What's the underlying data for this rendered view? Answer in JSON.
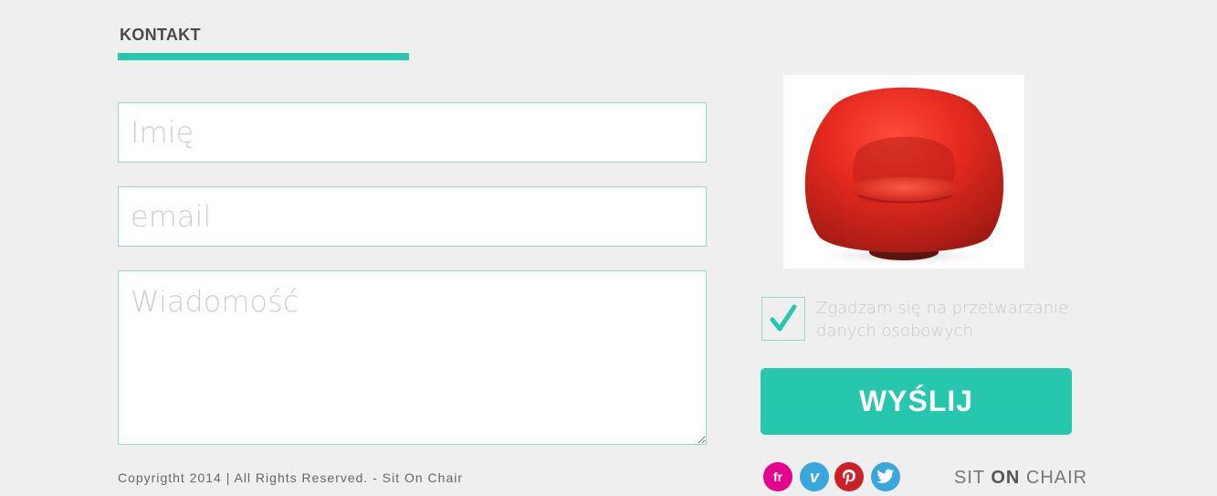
{
  "section": {
    "title": "KONTAKT"
  },
  "form": {
    "name_placeholder": "Imię",
    "email_placeholder": "email",
    "message_placeholder": "Wiadomość",
    "consent_checked": true,
    "consent_label": "Zgadzam się na przetwarzanie danych osobowych",
    "submit_label": "WYŚLIJ"
  },
  "footer": {
    "copyright": "Copyrigtht 2014 | All Rights Reserved. - Sit On Chair",
    "social": [
      {
        "name": "fr-icon",
        "label": "fr",
        "color": "#e3038d"
      },
      {
        "name": "vimeo-icon",
        "label": "v",
        "color": "#3aa6dc"
      },
      {
        "name": "pinterest-icon",
        "label": "p",
        "color": "#cb2027"
      },
      {
        "name": "twitter-icon",
        "label": "",
        "color": "#3aa6dc"
      }
    ],
    "brand": {
      "part1": "SIT",
      "part2": "ON",
      "part3": "CHAIR"
    }
  },
  "colors": {
    "accent": "#27c7ad",
    "background": "#efefef",
    "border": "#93d9cc"
  },
  "image": {
    "icon": "red-armchair"
  }
}
